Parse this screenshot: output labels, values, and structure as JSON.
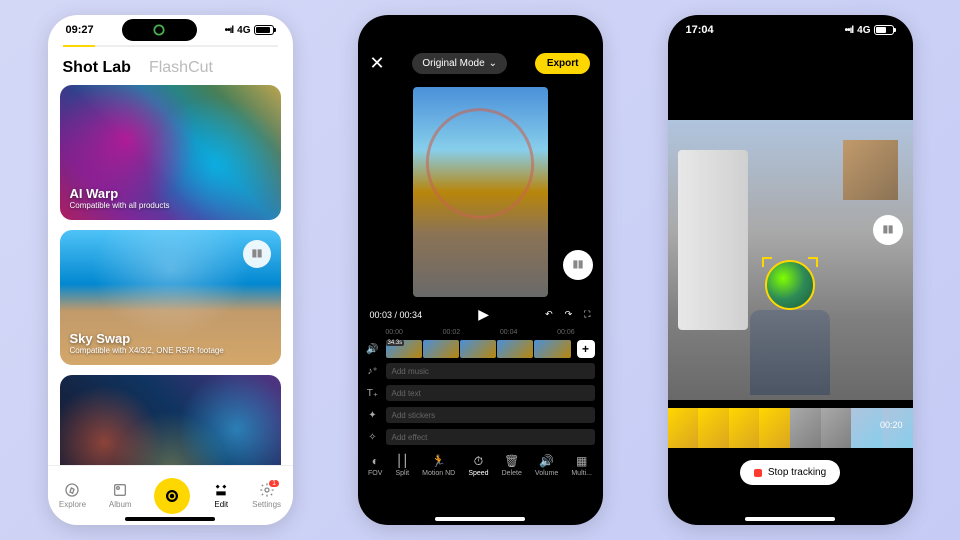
{
  "phone1": {
    "statusbar": {
      "time": "09:27",
      "network": "4G",
      "battery": "85",
      "battery_pct": 85
    },
    "tabs": {
      "active": "Shot Lab",
      "inactive": "FlashCut"
    },
    "cards": [
      {
        "title": "AI Warp",
        "subtitle": "Compatible with all products"
      },
      {
        "title": "Sky Swap",
        "subtitle": "Compatible with X4/3/2, ONE RS/R footage"
      },
      {
        "title": "",
        "subtitle": ""
      }
    ],
    "nav": {
      "explore": "Explore",
      "album": "Album",
      "edit": "Edit",
      "settings": "Settings",
      "badge": "1"
    }
  },
  "phone2": {
    "header": {
      "mode": "Original Mode",
      "export": "Export"
    },
    "transport": {
      "current": "00:03",
      "total": "00:34"
    },
    "ruler": [
      "00:00",
      "00:02",
      "00:04",
      "00:06"
    ],
    "clip_duration": "34.3s",
    "tracks": {
      "music": "Add music",
      "text": "Add text",
      "stickers": "Add stickers",
      "effect": "Add effect"
    },
    "tools": {
      "fov": "FOV",
      "split": "Split",
      "motion": "Motion ND",
      "speed": "Speed",
      "delete": "Delete",
      "volume": "Volume",
      "multi": "Multi..."
    }
  },
  "phone3": {
    "statusbar": {
      "time": "17:04",
      "network": "4G",
      "battery": "60",
      "battery_pct": 60
    },
    "timecode": "00:20",
    "button": "Stop tracking"
  }
}
